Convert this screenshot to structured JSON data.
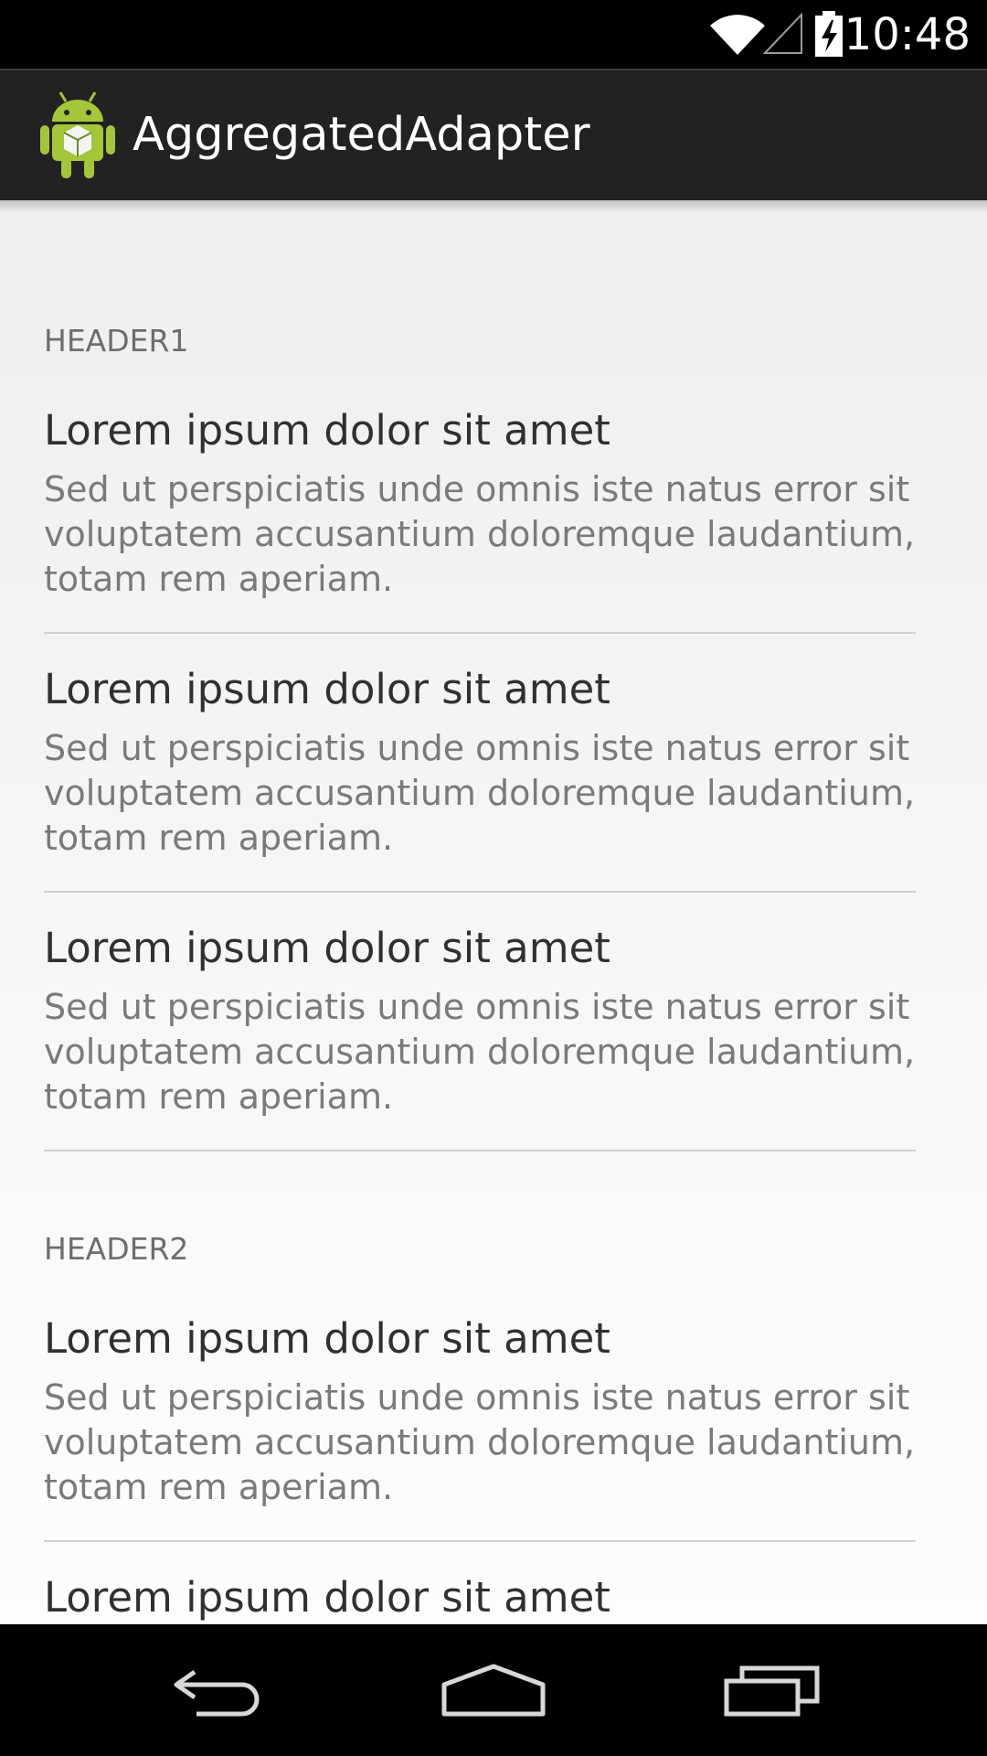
{
  "status_bar": {
    "time": "10:48",
    "icons": [
      "wifi-icon",
      "signal-icon",
      "battery-charging-icon"
    ]
  },
  "action_bar": {
    "title": "AggregatedAdapter",
    "icon": "android-app-icon",
    "icon_color": "#a4c639"
  },
  "sections": [
    {
      "header": "HEADER1",
      "items": [
        {
          "title": "Lorem ipsum dolor sit amet",
          "body": "Sed ut perspiciatis unde omnis iste natus error sit voluptatem accusantium doloremque laudantium, totam rem aperiam."
        },
        {
          "title": "Lorem ipsum dolor sit amet",
          "body": "Sed ut perspiciatis unde omnis iste natus error sit voluptatem accusantium doloremque laudantium, totam rem aperiam."
        },
        {
          "title": "Lorem ipsum dolor sit amet",
          "body": "Sed ut perspiciatis unde omnis iste natus error sit voluptatem accusantium doloremque laudantium, totam rem aperiam."
        }
      ]
    },
    {
      "header": "HEADER2",
      "items": [
        {
          "title": "Lorem ipsum dolor sit amet",
          "body": "Sed ut perspiciatis unde omnis iste natus error sit voluptatem accusantium doloremque laudantium, totam rem aperiam."
        },
        {
          "title": "Lorem ipsum dolor sit amet",
          "body": ""
        }
      ]
    }
  ],
  "nav_bar": {
    "icons": [
      "back-icon",
      "home-icon",
      "recent-apps-icon"
    ]
  }
}
